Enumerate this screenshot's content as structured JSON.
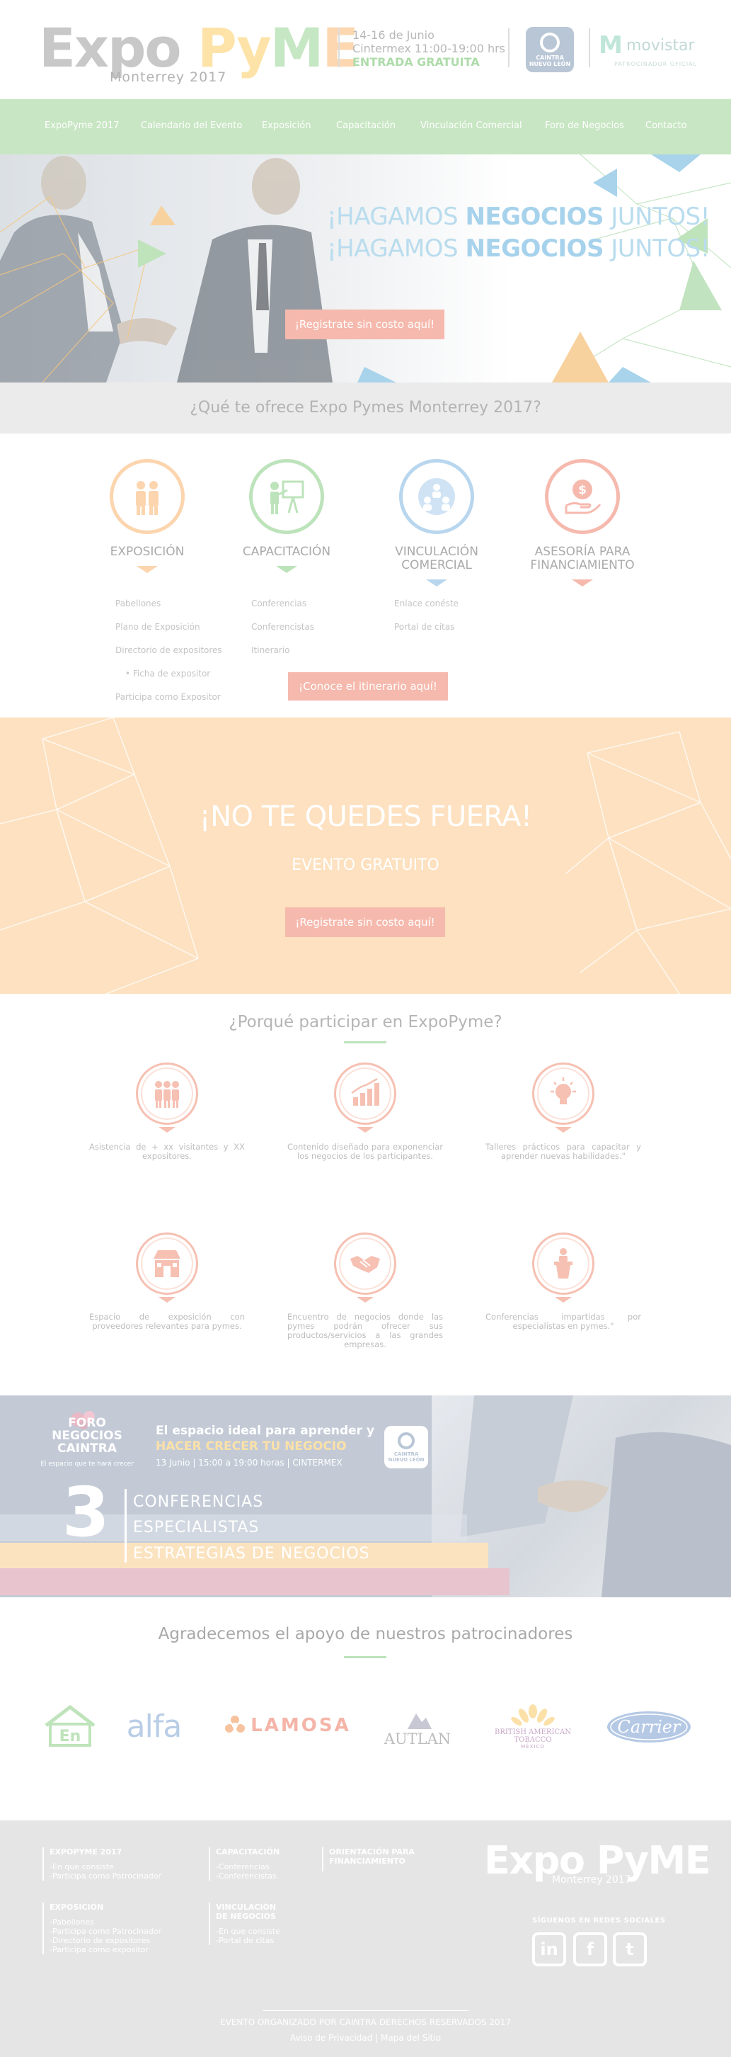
{
  "header": {
    "logo": {
      "expo": "Expo",
      "py": "Py",
      "m": "M",
      "e": "E",
      "sub": "Monterrey 2017"
    },
    "event": {
      "dates": "14-16 de Junio",
      "venue": "Cintermex 11:00-19:00 hrs",
      "free": "ENTRADA GRATUITA"
    },
    "caintra": "CAINTRA NUEVO LEÓN",
    "movistar": {
      "name": "movistar",
      "sponsor": "PATROCINADOR OFICIAL"
    }
  },
  "nav": [
    "ExpoPyme 2017",
    "Calendario del Evento",
    "Exposición",
    "Capacitación",
    "Vinculación Comercial",
    "Foro de Negocios",
    "Contacto"
  ],
  "hero": {
    "line1_pre": "¡HAGAMOS ",
    "line1_bold": "NEGOCIOS",
    "line1_post": " JUNTOS!",
    "line2_pre": "¡HAGAMOS ",
    "line2_bold": "NEGOCIOS",
    "line2_post": " JUNTOS!",
    "button": "¡Registrate sin costo aquí!"
  },
  "offer": {
    "title": "¿Qué te ofrece Expo Pymes Monterrey 2017?",
    "columns": [
      {
        "title": "EXPOSICIÓN",
        "color": "#fcd5ae",
        "links": [
          "Pabellones",
          "Plano de Exposición",
          "Directorio de expositores",
          "• Ficha de expositor",
          "Participa como Expositor"
        ]
      },
      {
        "title": "CAPACITACIÓN",
        "color": "#bde3bb",
        "links": [
          "Conferencias",
          "Conferencistas",
          "Itinerario"
        ]
      },
      {
        "title": "VINCULACIÓN COMERCIAL",
        "title_l1": "VINCULACIÓN",
        "title_l2": "COMERCIAL",
        "color": "#b8d6ee",
        "links": [
          "Enlace conéste",
          "Portal de citas"
        ]
      },
      {
        "title": "ASESORÍA PARA FINANCIAMIENTO",
        "title_l1": "ASESORÍA PARA",
        "title_l2": "FINANCIAMIENTO",
        "color": "#f6b9ad",
        "links": []
      }
    ],
    "button": "¡Conoce el itinerario aquí!"
  },
  "cta": {
    "title": "¡NO TE QUEDES FUERA!",
    "subtitle": "EVENTO GRATUITO",
    "button": "¡Registrate sin costo aquí!"
  },
  "why": {
    "title": "¿Porqué participar en ExpoPyme?",
    "items": [
      {
        "icon": "people-icon",
        "text": "Asistencia de + xx visitantes y XX expositores."
      },
      {
        "icon": "growth-chart-icon",
        "text": "Contenido diseñado para exponenciar los negocios de los participantes."
      },
      {
        "icon": "lightbulb-icon",
        "text": "Talleres prácticos para capacitar y aprender nuevas habilidades.\""
      },
      {
        "icon": "store-icon",
        "text": "Espacio de exposición con proveedores relevantes para pymes."
      },
      {
        "icon": "handshake-icon",
        "text": "Encuentro de negocios donde las pymes podrán ofrecer sus productos/servicios a las grandes empresas."
      },
      {
        "icon": "podium-icon",
        "text": "Conferencias impartidas por especialistas en pymes.\""
      }
    ]
  },
  "foro": {
    "brand_l1": "FORO NEGOCIOS",
    "brand_l2": "CAINTRA",
    "tagline": "El espacio que te hará crecer",
    "h1": "El espacio ideal para aprender y",
    "h2": "HACER CRECER TU NEGOCIO",
    "h3": "13 Junio | 15:00 a 19:00 horas | CINTERMEX",
    "badge": "CAINTRA NUEVO LEÓN",
    "number": "3",
    "list": [
      "CONFERENCIAS",
      "ESPECIALISTAS",
      "ESTRATEGIAS DE NEGOCIOS"
    ]
  },
  "sponsors": {
    "title": "Agradecemos el apoyo de nuestros patrocinadores",
    "logos": [
      "En",
      "alfa",
      "LAMOSA",
      "AUTLAN",
      "BRITISH AMERICAN TOBACCO",
      "MÉXICO",
      "Carrier"
    ]
  },
  "footer": {
    "col1": {
      "title": "EXPOPYME 2017",
      "items": [
        "-En que consiste",
        "-Participa como Patrocinador"
      ]
    },
    "col2": {
      "title": "CAPACITACIÓN",
      "items": [
        "-Conferencias",
        "-Conferencistas"
      ]
    },
    "col3": {
      "title_l1": "ORIENTACIÓN PARA",
      "title_l2": "FINANCIAMIENTO"
    },
    "col4": {
      "title": "EXPOSICIÓN",
      "items": [
        "-Pabellones",
        "-Participa como Patrocinador",
        "-Directorio de expositores",
        "-Participa como expositor"
      ]
    },
    "col5": {
      "title_l1": "VINCULACIÓN",
      "title_l2": "DE NEGOCIOS",
      "items": [
        "-En que consiste",
        "-Portal de citas"
      ]
    },
    "logo": "Expo PyME",
    "logo_sub": "Monterrey 2017",
    "social_title": "SÍGUENOS EN REDES SOCIALES",
    "social": [
      "in",
      "f",
      "t"
    ],
    "copyright": "EVENTO ORGANIZADO POR CAINTRA DERECHOS RESERVADOS 2017",
    "links": "Aviso de Privacidad | Mapa del Sitio"
  }
}
